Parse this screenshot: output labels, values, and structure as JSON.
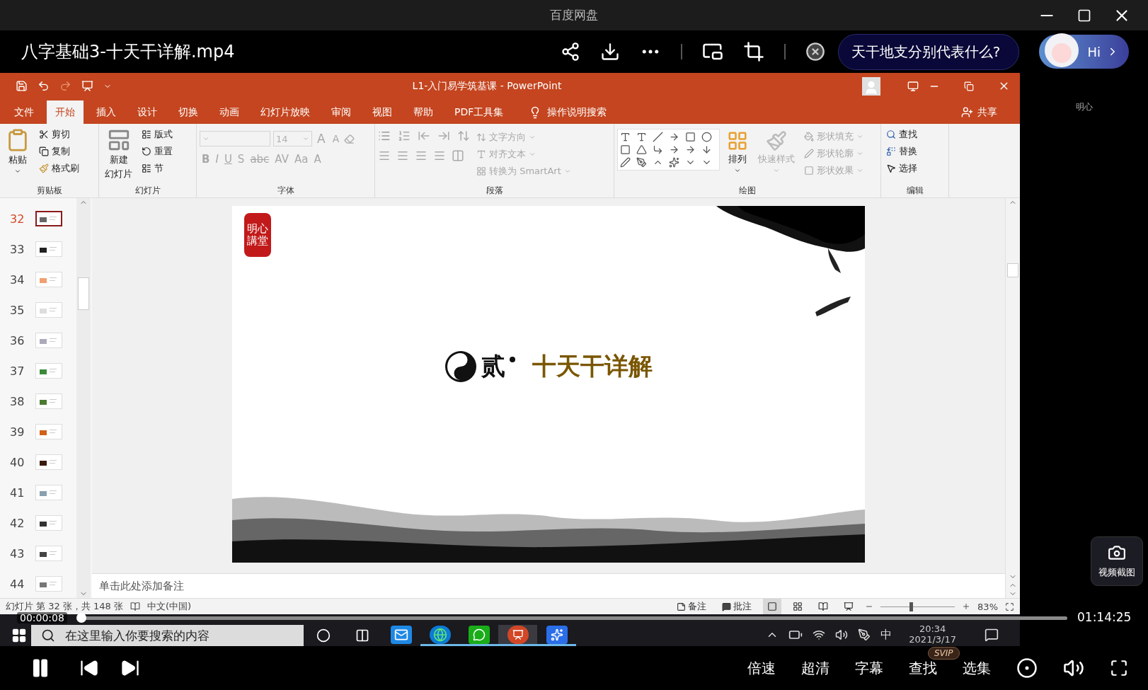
{
  "app": {
    "title": "百度网盘"
  },
  "header": {
    "video_title": "八字基础3-十天干详解.mp4",
    "question": "天干地支分别代表什么?",
    "greeting": "Hi"
  },
  "side_panel": {
    "label": "明心",
    "screenshot_label": "视频截图"
  },
  "powerpoint": {
    "title": "L1-入门易学筑基课  -  PowerPoint",
    "tabs": [
      {
        "label": "文件",
        "selected": false
      },
      {
        "label": "开始",
        "selected": true
      },
      {
        "label": "插入",
        "selected": false
      },
      {
        "label": "设计",
        "selected": false
      },
      {
        "label": "切换",
        "selected": false
      },
      {
        "label": "动画",
        "selected": false
      },
      {
        "label": "幻灯片放映",
        "selected": false
      },
      {
        "label": "审阅",
        "selected": false
      },
      {
        "label": "视图",
        "selected": false
      },
      {
        "label": "帮助",
        "selected": false
      },
      {
        "label": "PDF工具集",
        "selected": false
      }
    ],
    "tell_me": "操作说明搜索",
    "share": "共享",
    "ribbon": {
      "clipboard": {
        "label": "剪贴板",
        "paste": "粘贴",
        "commands": [
          {
            "label": "剪切"
          },
          {
            "label": "复制"
          },
          {
            "label": "格式刷"
          }
        ]
      },
      "slides": {
        "label": "幻灯片",
        "new_slide": [
          "新建",
          "幻灯片"
        ],
        "commands": [
          {
            "label": "版式"
          },
          {
            "label": "重置"
          },
          {
            "label": "节"
          }
        ]
      },
      "font": {
        "label": "字体",
        "disabled": true,
        "size": "14",
        "row_1": [
          "A",
          "A"
        ],
        "row_2": [
          "B",
          "I",
          "U",
          "S",
          "abc",
          "AV",
          "Aa",
          "A"
        ]
      },
      "paragraph": {
        "label": "段落",
        "disabled": true,
        "commands": [
          {
            "label": "文字方向"
          },
          {
            "label": "对齐文本"
          },
          {
            "label": "转换为 SmartArt"
          }
        ]
      },
      "drawing": {
        "label": "绘图",
        "commands": [
          {
            "label": "排列",
            "disabled": false
          },
          {
            "label": "快速样式",
            "disabled": true
          }
        ],
        "format": [
          {
            "label": "形状填充",
            "disabled": true
          },
          {
            "label": "形状轮廓",
            "disabled": true
          },
          {
            "label": "形状效果",
            "disabled": true
          }
        ]
      },
      "editing": {
        "label": "编辑",
        "commands": [
          {
            "label": "查找",
            "disabled": false
          },
          {
            "label": "替换",
            "disabled": false
          },
          {
            "label": "选择",
            "disabled": false
          }
        ]
      }
    },
    "thumbnails": [
      {
        "number": "32",
        "selected": true
      },
      {
        "number": "33",
        "selected": false
      },
      {
        "number": "34",
        "selected": false
      },
      {
        "number": "35",
        "selected": false
      },
      {
        "number": "36",
        "selected": false
      },
      {
        "number": "37",
        "selected": false
      },
      {
        "number": "38",
        "selected": false
      },
      {
        "number": "39",
        "selected": false
      },
      {
        "number": "40",
        "selected": false
      },
      {
        "number": "41",
        "selected": false
      },
      {
        "number": "42",
        "selected": false
      },
      {
        "number": "43",
        "selected": false
      },
      {
        "number": "44",
        "selected": false
      }
    ],
    "slide": {
      "stamp": [
        "明心",
        "講堂"
      ],
      "numeral": "贰",
      "heading": "十天干详解"
    },
    "notes_placeholder": "单击此处添加备注",
    "status": {
      "slide_info": "幻灯片 第 32 张，共 148 张",
      "language": "中文(中国)",
      "notes": "备注",
      "comments": "批注",
      "zoom": "83%",
      "zoom_slider": {
        "level": 0.41
      }
    }
  },
  "taskbar": {
    "search_placeholder": "在这里输入你要搜索的内容",
    "apps": [
      {
        "kind": "mail",
        "running": false
      },
      {
        "kind": "edge",
        "running": true
      },
      {
        "kind": "wechat",
        "running": true
      },
      {
        "kind": "powerpoint",
        "running": true,
        "selected": true
      },
      {
        "kind": "lark",
        "running": true
      }
    ],
    "ime": "中",
    "time": "20:34",
    "date": "2021/3/17"
  },
  "playback": {
    "elapsed": "00:00:08",
    "total": "01:14:25",
    "progress": {
      "level": 0.002
    },
    "playing": true,
    "badge": "SVIP",
    "options": [
      "倍速",
      "超清",
      "字幕",
      "查找",
      "选集"
    ]
  }
}
